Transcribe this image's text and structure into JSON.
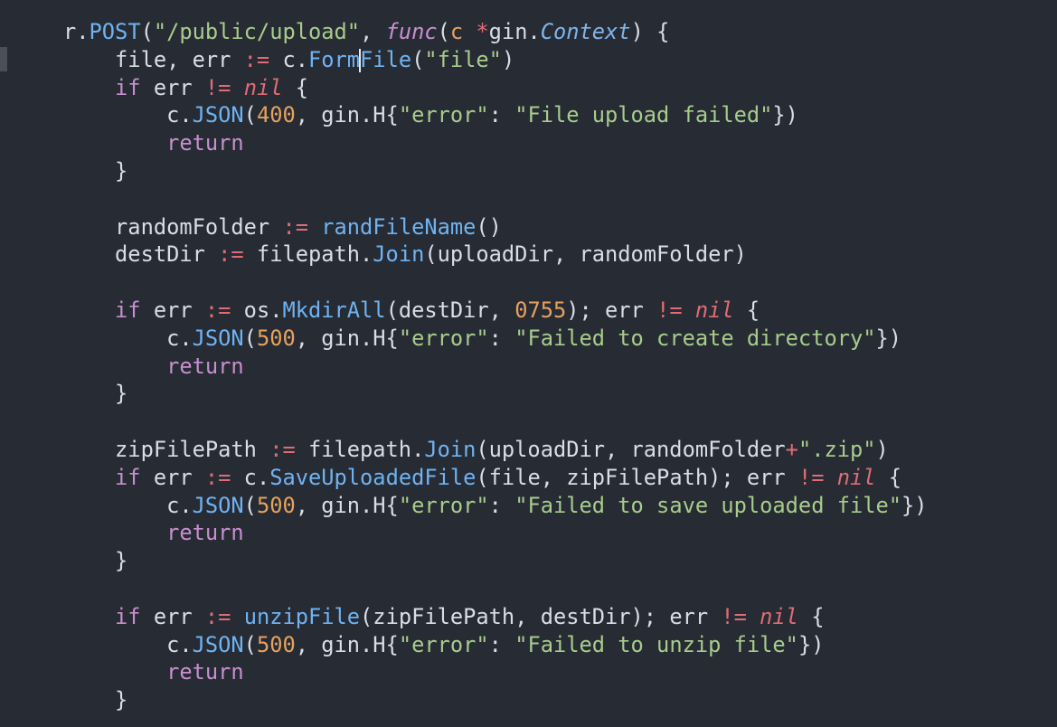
{
  "editor": {
    "language": "go",
    "cursor": {
      "line": 2,
      "after_token": "Form"
    },
    "colors": {
      "background": "#272b33",
      "plain": "#d8dee6",
      "function": "#6fb3f2",
      "string": "#a8cc8c",
      "keyword": "#c88fd0",
      "operator": "#e06c75",
      "number": "#e5a25f"
    },
    "lines": [
      {
        "indent": 0,
        "tokens": [
          {
            "t": "r",
            "k": "plain"
          },
          {
            "t": ".",
            "k": "plain"
          },
          {
            "t": "POST",
            "k": "func"
          },
          {
            "t": "(",
            "k": "plain"
          },
          {
            "t": "\"/public/upload\"",
            "k": "str"
          },
          {
            "t": ", ",
            "k": "plain"
          },
          {
            "t": "func",
            "k": "kwi"
          },
          {
            "t": "(",
            "k": "plain"
          },
          {
            "t": "c",
            "k": "num"
          },
          {
            "t": " ",
            "k": "plain"
          },
          {
            "t": "*",
            "k": "op"
          },
          {
            "t": "gin",
            "k": "plain"
          },
          {
            "t": ".",
            "k": "plain"
          },
          {
            "t": "Context",
            "k": "type"
          },
          {
            "t": ") {",
            "k": "plain"
          }
        ]
      },
      {
        "indent": 1,
        "tokens": [
          {
            "t": "file, err ",
            "k": "plain"
          },
          {
            "t": ":=",
            "k": "op"
          },
          {
            "t": " c.",
            "k": "plain"
          },
          {
            "t": "Form",
            "k": "func"
          },
          {
            "t": "|",
            "k": "cursor"
          },
          {
            "t": "File",
            "k": "func"
          },
          {
            "t": "(",
            "k": "plain"
          },
          {
            "t": "\"file\"",
            "k": "str"
          },
          {
            "t": ")",
            "k": "plain"
          }
        ]
      },
      {
        "indent": 1,
        "tokens": [
          {
            "t": "if",
            "k": "kw"
          },
          {
            "t": " err ",
            "k": "plain"
          },
          {
            "t": "!=",
            "k": "op"
          },
          {
            "t": " ",
            "k": "plain"
          },
          {
            "t": "nil",
            "k": "nil"
          },
          {
            "t": " {",
            "k": "plain"
          }
        ]
      },
      {
        "indent": 2,
        "tokens": [
          {
            "t": "c.",
            "k": "plain"
          },
          {
            "t": "JSON",
            "k": "func"
          },
          {
            "t": "(",
            "k": "plain"
          },
          {
            "t": "400",
            "k": "num"
          },
          {
            "t": ", gin.H{",
            "k": "plain"
          },
          {
            "t": "\"error\"",
            "k": "str"
          },
          {
            "t": ": ",
            "k": "plain"
          },
          {
            "t": "\"File upload failed\"",
            "k": "str"
          },
          {
            "t": "})",
            "k": "plain"
          }
        ]
      },
      {
        "indent": 2,
        "tokens": [
          {
            "t": "return",
            "k": "kw"
          }
        ]
      },
      {
        "indent": 1,
        "tokens": [
          {
            "t": "}",
            "k": "plain"
          }
        ]
      },
      {
        "indent": 0,
        "tokens": []
      },
      {
        "indent": 1,
        "tokens": [
          {
            "t": "randomFolder ",
            "k": "plain"
          },
          {
            "t": ":=",
            "k": "op"
          },
          {
            "t": " ",
            "k": "plain"
          },
          {
            "t": "randFileName",
            "k": "func"
          },
          {
            "t": "()",
            "k": "plain"
          }
        ]
      },
      {
        "indent": 1,
        "tokens": [
          {
            "t": "destDir ",
            "k": "plain"
          },
          {
            "t": ":=",
            "k": "op"
          },
          {
            "t": " filepath.",
            "k": "plain"
          },
          {
            "t": "Join",
            "k": "func"
          },
          {
            "t": "(uploadDir, randomFolder)",
            "k": "plain"
          }
        ]
      },
      {
        "indent": 0,
        "tokens": []
      },
      {
        "indent": 1,
        "tokens": [
          {
            "t": "if",
            "k": "kw"
          },
          {
            "t": " err ",
            "k": "plain"
          },
          {
            "t": ":=",
            "k": "op"
          },
          {
            "t": " os.",
            "k": "plain"
          },
          {
            "t": "MkdirAll",
            "k": "func"
          },
          {
            "t": "(destDir, ",
            "k": "plain"
          },
          {
            "t": "0755",
            "k": "num"
          },
          {
            "t": "); err ",
            "k": "plain"
          },
          {
            "t": "!=",
            "k": "op"
          },
          {
            "t": " ",
            "k": "plain"
          },
          {
            "t": "nil",
            "k": "nil"
          },
          {
            "t": " {",
            "k": "plain"
          }
        ]
      },
      {
        "indent": 2,
        "tokens": [
          {
            "t": "c.",
            "k": "plain"
          },
          {
            "t": "JSON",
            "k": "func"
          },
          {
            "t": "(",
            "k": "plain"
          },
          {
            "t": "500",
            "k": "num"
          },
          {
            "t": ", gin.H{",
            "k": "plain"
          },
          {
            "t": "\"error\"",
            "k": "str"
          },
          {
            "t": ": ",
            "k": "plain"
          },
          {
            "t": "\"Failed to create directory\"",
            "k": "str"
          },
          {
            "t": "})",
            "k": "plain"
          }
        ]
      },
      {
        "indent": 2,
        "tokens": [
          {
            "t": "return",
            "k": "kw"
          }
        ]
      },
      {
        "indent": 1,
        "tokens": [
          {
            "t": "}",
            "k": "plain"
          }
        ]
      },
      {
        "indent": 0,
        "tokens": []
      },
      {
        "indent": 1,
        "tokens": [
          {
            "t": "zipFilePath ",
            "k": "plain"
          },
          {
            "t": ":=",
            "k": "op"
          },
          {
            "t": " filepath.",
            "k": "plain"
          },
          {
            "t": "Join",
            "k": "func"
          },
          {
            "t": "(uploadDir, randomFolder",
            "k": "plain"
          },
          {
            "t": "+",
            "k": "op"
          },
          {
            "t": "\".zip\"",
            "k": "str"
          },
          {
            "t": ")",
            "k": "plain"
          }
        ]
      },
      {
        "indent": 1,
        "tokens": [
          {
            "t": "if",
            "k": "kw"
          },
          {
            "t": " err ",
            "k": "plain"
          },
          {
            "t": ":=",
            "k": "op"
          },
          {
            "t": " c.",
            "k": "plain"
          },
          {
            "t": "SaveUploadedFile",
            "k": "func"
          },
          {
            "t": "(file, zipFilePath); err ",
            "k": "plain"
          },
          {
            "t": "!=",
            "k": "op"
          },
          {
            "t": " ",
            "k": "plain"
          },
          {
            "t": "nil",
            "k": "nil"
          },
          {
            "t": " {",
            "k": "plain"
          }
        ]
      },
      {
        "indent": 2,
        "tokens": [
          {
            "t": "c.",
            "k": "plain"
          },
          {
            "t": "JSON",
            "k": "func"
          },
          {
            "t": "(",
            "k": "plain"
          },
          {
            "t": "500",
            "k": "num"
          },
          {
            "t": ", gin.H{",
            "k": "plain"
          },
          {
            "t": "\"error\"",
            "k": "str"
          },
          {
            "t": ": ",
            "k": "plain"
          },
          {
            "t": "\"Failed to save uploaded file\"",
            "k": "str"
          },
          {
            "t": "})",
            "k": "plain"
          }
        ]
      },
      {
        "indent": 2,
        "tokens": [
          {
            "t": "return",
            "k": "kw"
          }
        ]
      },
      {
        "indent": 1,
        "tokens": [
          {
            "t": "}",
            "k": "plain"
          }
        ]
      },
      {
        "indent": 0,
        "tokens": []
      },
      {
        "indent": 1,
        "tokens": [
          {
            "t": "if",
            "k": "kw"
          },
          {
            "t": " err ",
            "k": "plain"
          },
          {
            "t": ":=",
            "k": "op"
          },
          {
            "t": " ",
            "k": "plain"
          },
          {
            "t": "unzipFile",
            "k": "func"
          },
          {
            "t": "(zipFilePath, destDir); err ",
            "k": "plain"
          },
          {
            "t": "!=",
            "k": "op"
          },
          {
            "t": " ",
            "k": "plain"
          },
          {
            "t": "nil",
            "k": "nil"
          },
          {
            "t": " {",
            "k": "plain"
          }
        ]
      },
      {
        "indent": 2,
        "tokens": [
          {
            "t": "c.",
            "k": "plain"
          },
          {
            "t": "JSON",
            "k": "func"
          },
          {
            "t": "(",
            "k": "plain"
          },
          {
            "t": "500",
            "k": "num"
          },
          {
            "t": ", gin.H{",
            "k": "plain"
          },
          {
            "t": "\"error\"",
            "k": "str"
          },
          {
            "t": ": ",
            "k": "plain"
          },
          {
            "t": "\"Failed to unzip file\"",
            "k": "str"
          },
          {
            "t": "})",
            "k": "plain"
          }
        ]
      },
      {
        "indent": 2,
        "tokens": [
          {
            "t": "return",
            "k": "kw"
          }
        ]
      },
      {
        "indent": 1,
        "tokens": [
          {
            "t": "}",
            "k": "plain"
          }
        ]
      }
    ]
  }
}
